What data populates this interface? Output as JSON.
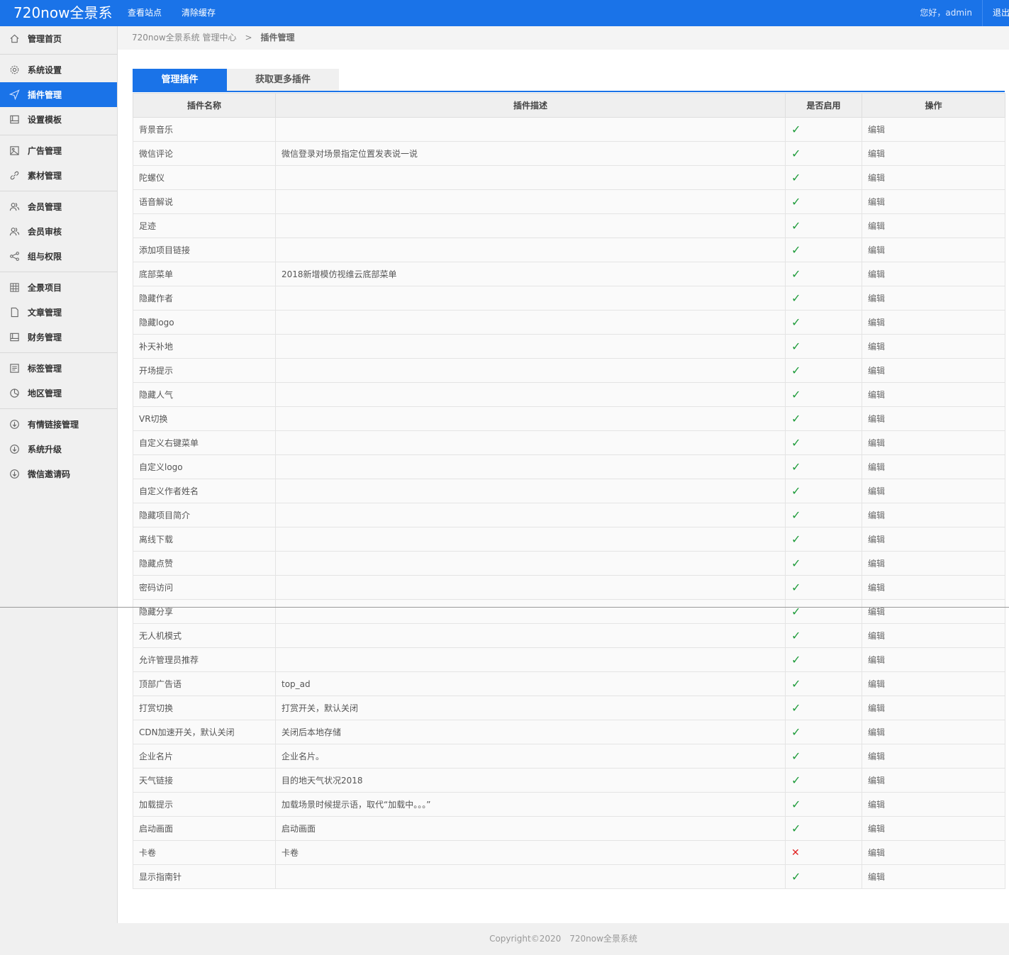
{
  "app": {
    "logo": "720now全景系",
    "nav": [
      "查看站点",
      "清除缓存"
    ],
    "greeting": "您好，admin",
    "logout": "退出"
  },
  "sidebar": {
    "groups": [
      [
        {
          "label": "管理首页",
          "icon": "home-icon"
        }
      ],
      [
        {
          "label": "系统设置",
          "icon": "gear-icon"
        },
        {
          "label": "插件管理",
          "icon": "send-icon",
          "active": true
        },
        {
          "label": "设置模板",
          "icon": "template-icon"
        }
      ],
      [
        {
          "label": "广告管理",
          "icon": "image-icon"
        },
        {
          "label": "素材管理",
          "icon": "link-icon"
        }
      ],
      [
        {
          "label": "会员管理",
          "icon": "users-icon"
        },
        {
          "label": "会员审核",
          "icon": "users-icon"
        },
        {
          "label": "组与权限",
          "icon": "share-icon"
        }
      ],
      [
        {
          "label": "全景项目",
          "icon": "grid-icon"
        },
        {
          "label": "文章管理",
          "icon": "file-icon"
        },
        {
          "label": "财务管理",
          "icon": "template-icon"
        }
      ],
      [
        {
          "label": "标签管理",
          "icon": "list-icon"
        },
        {
          "label": "地区管理",
          "icon": "pie-icon"
        }
      ],
      [
        {
          "label": "有情链接管理",
          "icon": "download-icon"
        },
        {
          "label": "系统升级",
          "icon": "download-icon"
        },
        {
          "label": "微信邀请码",
          "icon": "download-icon"
        }
      ]
    ]
  },
  "breadcrumb": {
    "root": "720now全景系统 管理中心",
    "sep": ">",
    "current": "插件管理"
  },
  "tabs": {
    "manage": "管理插件",
    "more": "获取更多插件"
  },
  "table": {
    "headers": [
      "插件名称",
      "插件描述",
      "是否启用",
      "操作"
    ],
    "edit_label": "编辑",
    "rows": [
      {
        "name": "背景音乐",
        "desc": "",
        "enabled": true
      },
      {
        "name": "微信评论",
        "desc": "微信登录对场景指定位置发表说一说",
        "enabled": true
      },
      {
        "name": "陀螺仪",
        "desc": "",
        "enabled": true
      },
      {
        "name": "语音解说",
        "desc": "",
        "enabled": true
      },
      {
        "name": "足迹",
        "desc": "",
        "enabled": true
      },
      {
        "name": "添加项目链接",
        "desc": "",
        "enabled": true
      },
      {
        "name": "底部菜单",
        "desc": "2018新增模仿视维云底部菜单",
        "enabled": true
      },
      {
        "name": "隐藏作者",
        "desc": "",
        "enabled": true
      },
      {
        "name": "隐藏logo",
        "desc": "",
        "enabled": true
      },
      {
        "name": "补天补地",
        "desc": "",
        "enabled": true
      },
      {
        "name": "开场提示",
        "desc": "",
        "enabled": true
      },
      {
        "name": "隐藏人气",
        "desc": "",
        "enabled": true
      },
      {
        "name": "VR切换",
        "desc": "",
        "enabled": true
      },
      {
        "name": "自定义右键菜单",
        "desc": "",
        "enabled": true
      },
      {
        "name": "自定义logo",
        "desc": "",
        "enabled": true
      },
      {
        "name": "自定义作者姓名",
        "desc": "",
        "enabled": true
      },
      {
        "name": "隐藏项目简介",
        "desc": "",
        "enabled": true
      },
      {
        "name": "离线下载",
        "desc": "",
        "enabled": true
      },
      {
        "name": "隐藏点赞",
        "desc": "",
        "enabled": true
      },
      {
        "name": "密码访问",
        "desc": "",
        "enabled": true
      },
      {
        "name": "隐藏分享",
        "desc": "",
        "enabled": true
      },
      {
        "name": "无人机模式",
        "desc": "",
        "enabled": true
      },
      {
        "name": "允许管理员推荐",
        "desc": "",
        "enabled": true
      },
      {
        "name": "顶部广告语",
        "desc": "top_ad",
        "enabled": true
      },
      {
        "name": "打赏切换",
        "desc": "打赏开关，默认关闭",
        "enabled": true
      },
      {
        "name": "CDN加速开关，默认关闭",
        "desc": "关闭后本地存储",
        "enabled": true
      },
      {
        "name": "企业名片",
        "desc": "企业名片。",
        "enabled": true
      },
      {
        "name": "天气链接",
        "desc": "目的地天气状况2018",
        "enabled": true
      },
      {
        "name": "加载提示",
        "desc": "加载场景时候提示语，取代“加载中。。。”",
        "enabled": true
      },
      {
        "name": "启动画面",
        "desc": "启动画面",
        "enabled": true
      },
      {
        "name": "卡卷",
        "desc": "卡卷",
        "enabled": false
      },
      {
        "name": "显示指南针",
        "desc": "",
        "enabled": true
      }
    ]
  },
  "footer": {
    "copyright": "Copyright©2020",
    "brand": "720now全景系统"
  },
  "colors": {
    "accent": "#1a73e8",
    "check": "#1f9c3b",
    "cross": "#e02020"
  }
}
